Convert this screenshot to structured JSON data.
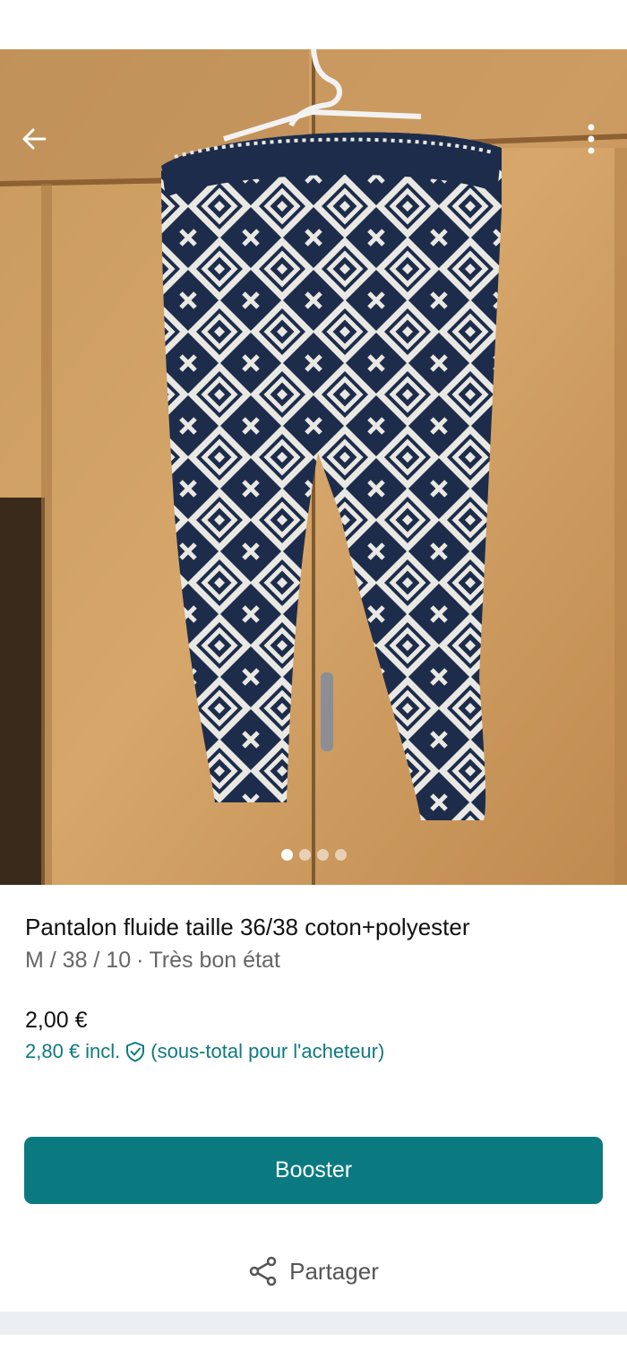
{
  "listing": {
    "title": "Pantalon fluide taille 36/38 coton+polyester",
    "size": "M / 38 / 10",
    "separator": "·",
    "condition": "Très bon état",
    "price": "2,00 €",
    "buyer_price": "2,80 €",
    "buyer_price_incl": "incl.",
    "buyer_price_note": "(sous-total pour l'acheteur)"
  },
  "gallery": {
    "photo_count": 4,
    "current_index": 1
  },
  "actions": {
    "booster_label": "Booster",
    "share_label": "Partager"
  },
  "icons": {
    "back": "arrow-left-icon",
    "more": "more-vertical-icon",
    "shield": "shield-check-icon",
    "share": "share-icon"
  },
  "colors": {
    "accent": "#0b7a80",
    "buyer_price_text": "#0e7a80",
    "subtitle": "#666666"
  }
}
